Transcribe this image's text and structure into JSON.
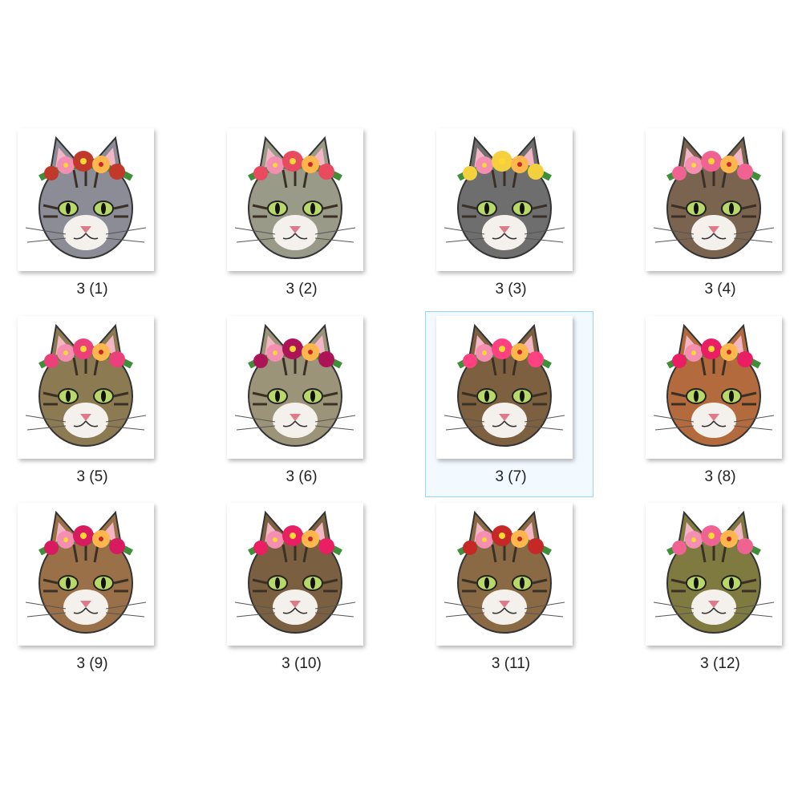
{
  "files": [
    {
      "label": "3 (1)",
      "thumbnail": "cat-flower-crown-icon",
      "fur": "#8c8c96",
      "flower": "#c0392b",
      "bg": "#ffffff",
      "selected": false
    },
    {
      "label": "3 (2)",
      "thumbnail": "cat-flower-crown-icon",
      "fur": "#9a9a88",
      "flower": "#e84a5f",
      "bg": "#ffffff",
      "selected": false
    },
    {
      "label": "3 (3)",
      "thumbnail": "cat-flower-crown-icon",
      "fur": "#6e6e6e",
      "flower": "#f4d03f",
      "bg": "#ffffff",
      "selected": false
    },
    {
      "label": "3 (4)",
      "thumbnail": "cat-flower-crown-icon",
      "fur": "#7a6450",
      "flower": "#f06292",
      "bg": "#ffffff",
      "selected": false
    },
    {
      "label": "3 (5)",
      "thumbnail": "cat-flower-crown-icon",
      "fur": "#8b7a52",
      "flower": "#ec407a",
      "bg": "#ffffff",
      "selected": false
    },
    {
      "label": "3 (6)",
      "thumbnail": "cat-flower-crown-icon",
      "fur": "#9c9478",
      "flower": "#ad1457",
      "bg": "#ffffff",
      "selected": false
    },
    {
      "label": "3 (7)",
      "thumbnail": "cat-flower-crown-icon",
      "fur": "#7d6040",
      "flower": "#ff4081",
      "bg": "#ffffff",
      "selected": true
    },
    {
      "label": "3 (8)",
      "thumbnail": "cat-flower-crown-icon",
      "fur": "#b36a3c",
      "flower": "#e91e63",
      "bg": "#ffffff",
      "selected": false
    },
    {
      "label": "3 (9)",
      "thumbnail": "cat-flower-crown-icon",
      "fur": "#9a7048",
      "flower": "#d81b60",
      "bg": "#ffffff",
      "selected": false
    },
    {
      "label": "3 (10)",
      "thumbnail": "cat-flower-crown-icon",
      "fur": "#7a6040",
      "flower": "#e91e63",
      "bg": "#ffffff",
      "selected": false
    },
    {
      "label": "3 (11)",
      "thumbnail": "cat-flower-crown-icon",
      "fur": "#8a6a44",
      "flower": "#c62828",
      "bg": "#ffffff",
      "selected": false
    },
    {
      "label": "3 (12)",
      "thumbnail": "cat-flower-crown-icon",
      "fur": "#7e7a40",
      "flower": "#f06292",
      "bg": "#ffffff",
      "selected": false
    }
  ],
  "colors": {
    "selection_border": "#99d1ff",
    "label_text": "#222222"
  }
}
